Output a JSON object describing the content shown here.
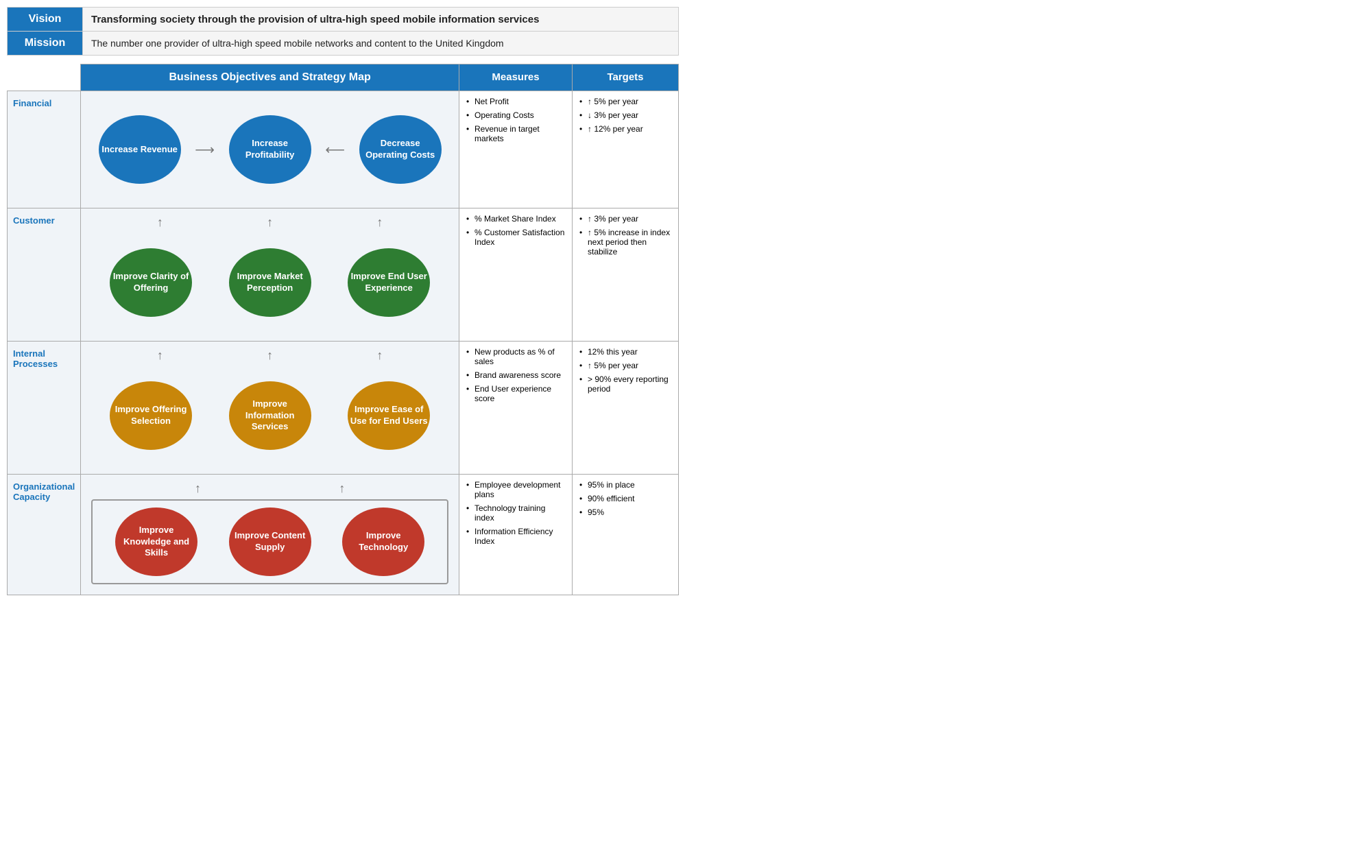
{
  "vision": {
    "label": "Vision",
    "text": "Transforming society through the provision of ultra-high speed mobile information services"
  },
  "mission": {
    "label": "Mission",
    "text": "The number one provider of ultra-high speed mobile networks and content to the United Kingdom"
  },
  "table": {
    "col1_header": "Business Objectives and Strategy Map",
    "col2_header": "Measures",
    "col3_header": "Targets",
    "rows": [
      {
        "label": "Financial",
        "nodes": [
          {
            "text": "Increase Revenue",
            "color": "blue"
          },
          {
            "text": "Increase Profitability",
            "color": "blue"
          },
          {
            "text": "Decrease Operating Costs",
            "color": "blue"
          }
        ],
        "measures": [
          "Net Profit",
          "Operating Costs",
          "Revenue in target markets"
        ],
        "targets": [
          "↑ 5% per year",
          "↓ 3% per year",
          "↑ 12% per year"
        ]
      },
      {
        "label": "Customer",
        "nodes": [
          {
            "text": "Improve Clarity of Offering",
            "color": "green"
          },
          {
            "text": "Improve Market Perception",
            "color": "green"
          },
          {
            "text": "Improve End User Experience",
            "color": "green"
          }
        ],
        "measures": [
          "% Market Share Index",
          "% Customer Satisfaction Index"
        ],
        "targets": [
          "↑ 3% per year",
          "↑ 5% increase in index next period then stabilize"
        ]
      },
      {
        "label": "Internal Processes",
        "nodes": [
          {
            "text": "Improve Offering Selection",
            "color": "gold"
          },
          {
            "text": "Improve Information Services",
            "color": "gold"
          },
          {
            "text": "Improve Ease of Use for End Users",
            "color": "gold"
          }
        ],
        "measures": [
          "New products as % of sales",
          "Brand awareness score",
          "End User experience score"
        ],
        "targets": [
          "12% this year",
          "↑ 5% per year",
          "> 90% every reporting period"
        ]
      },
      {
        "label": "Organizational Capacity",
        "nodes": [
          {
            "text": "Improve Knowledge and Skills",
            "color": "red"
          },
          {
            "text": "Improve Content Supply",
            "color": "red"
          },
          {
            "text": "Improve Technology",
            "color": "red"
          }
        ],
        "measures": [
          "Employee development plans",
          "Technology training index",
          "Information Efficiency Index"
        ],
        "targets": [
          "95% in place",
          "90% efficient",
          "95%"
        ]
      }
    ]
  }
}
